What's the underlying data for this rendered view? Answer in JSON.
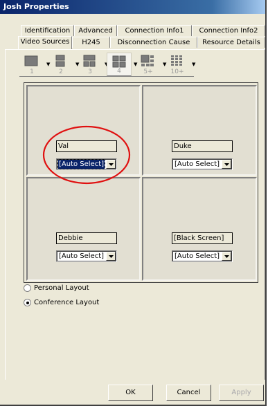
{
  "window": {
    "title": "Josh Properties"
  },
  "tabs": {
    "row1": [
      "Identification",
      "Advanced",
      "Connection Info1",
      "Connection Info2"
    ],
    "row2": [
      "Video Sources",
      "H245",
      "Disconnection Cause",
      "Resource Details"
    ],
    "active": "Video Sources"
  },
  "layouts": {
    "options": [
      {
        "label": "1",
        "icon": "single-view-icon"
      },
      {
        "label": "2",
        "icon": "two-view-icon"
      },
      {
        "label": "3",
        "icon": "three-view-icon"
      },
      {
        "label": "4",
        "icon": "quad-view-icon"
      },
      {
        "label": "5+",
        "icon": "five-plus-view-icon"
      },
      {
        "label": "10+",
        "icon": "ten-plus-view-icon"
      }
    ],
    "selected": "4"
  },
  "cells": [
    {
      "name": "Val",
      "source": "[Auto Select]"
    },
    {
      "name": "Duke",
      "source": "[Auto Select]"
    },
    {
      "name": "Debbie",
      "source": "[Auto Select]"
    },
    {
      "name": "[Black Screen]",
      "source": "[Auto Select]"
    }
  ],
  "layout_mode": {
    "options": [
      "Personal Layout",
      "Conference Layout"
    ],
    "selected": "Conference Layout"
  },
  "buttons": {
    "ok": "OK",
    "cancel": "Cancel",
    "apply": "Apply"
  },
  "annotation": {
    "color": "#e01010"
  }
}
